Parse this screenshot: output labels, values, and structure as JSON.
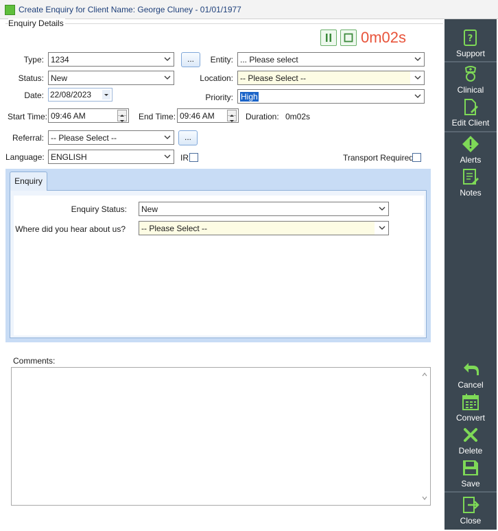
{
  "window": {
    "title": "Create Enquiry for Client Name: George Cluney - 01/01/1977"
  },
  "group": {
    "legend": "Enquiry Details"
  },
  "timer": {
    "value": "0m02s"
  },
  "fields": {
    "type_label": "Type:",
    "type_value": "1234",
    "entity_label": "Entity:",
    "entity_value": "... Please select",
    "status_label": "Status:",
    "status_value": "New",
    "location_label": "Location:",
    "location_value": "-- Please Select --",
    "date_label": "Date:",
    "date_value": "22/08/2023",
    "priority_label": "Priority:",
    "priority_value": "High",
    "start_label": "Start Time:",
    "start_value": "09:46 AM",
    "end_label": "End Time:",
    "end_value": "09:46 AM",
    "duration_label": "Duration:",
    "duration_value": "0m02s",
    "referral_label": "Referral:",
    "referral_value": "-- Please Select --",
    "language_label": "Language:",
    "language_value": "ENGLISH",
    "ir_label": "IR",
    "transport_label": "Transport Required",
    "dots_label": "..."
  },
  "tabs": [
    {
      "label": "Enquiry"
    }
  ],
  "enquiry_tab": {
    "status_label": "Enquiry Status:",
    "status_value": "New",
    "hear_label": "Where did you hear about us?",
    "hear_value": "-- Please Select --"
  },
  "comments": {
    "label": "Comments:",
    "value": ""
  },
  "sidebar": {
    "items": [
      {
        "label": "Support",
        "icon": "support-icon"
      },
      {
        "label": "Clinical",
        "icon": "clinical-icon"
      },
      {
        "label": "Edit Client",
        "icon": "edit-client-icon"
      },
      {
        "label": "Alerts",
        "icon": "alert-icon"
      },
      {
        "label": "Notes",
        "icon": "notes-icon"
      },
      {
        "label": "Cancel",
        "icon": "cancel-icon"
      },
      {
        "label": "Convert",
        "icon": "convert-icon"
      },
      {
        "label": "Delete",
        "icon": "delete-icon"
      },
      {
        "label": "Save",
        "icon": "save-icon"
      },
      {
        "label": "Close",
        "icon": "close-icon"
      }
    ]
  },
  "colors": {
    "sidebar_bg": "#3b4751",
    "icon_green": "#7ed957",
    "timer_color": "#e8533a",
    "tab_area_bg": "#c8dcf5",
    "yellow_field": "#fdfce4"
  }
}
